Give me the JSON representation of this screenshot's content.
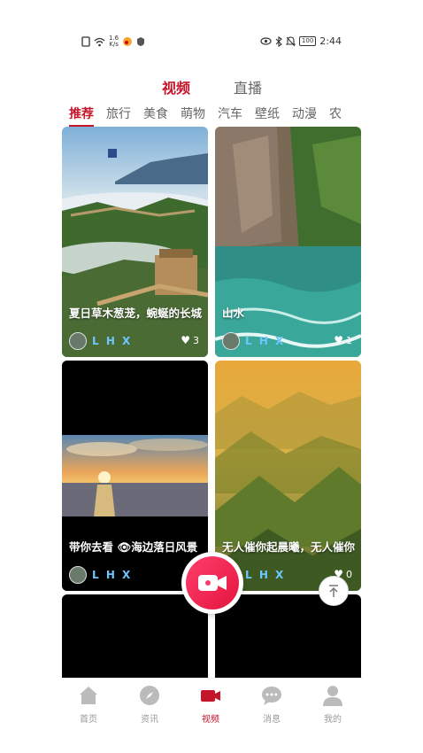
{
  "status_bar": {
    "speed_value": "1.6",
    "speed_unit": "K/s",
    "battery": "100",
    "time": "2:44"
  },
  "top_tabs": [
    {
      "label": "视频",
      "active": true
    },
    {
      "label": "直播",
      "active": false
    }
  ],
  "categories": [
    "推荐",
    "旅行",
    "美食",
    "萌物",
    "汽车",
    "壁纸",
    "动漫",
    "农"
  ],
  "selected_category": "推荐",
  "feed": [
    {
      "title": "夏日草木葱茏，蜿蜒的长城",
      "user": "L H X",
      "likes": "3",
      "image": "great-wall-mountains"
    },
    {
      "title": "山水",
      "user": "L H X",
      "likes": "1",
      "image": "river-cliffs"
    },
    {
      "title": "带你去看 👁海边落日风景",
      "user": "L H X",
      "likes": "",
      "image": "sea-sunset"
    },
    {
      "title": "无人催你起晨曦，无人催你",
      "user": "L H X",
      "likes": "0",
      "image": "misty-mountains"
    }
  ],
  "bottom_nav": [
    {
      "label": "首页",
      "icon": "home-icon"
    },
    {
      "label": "资讯",
      "icon": "compass-icon"
    },
    {
      "label": "视频",
      "icon": "video-camera-icon",
      "active": true
    },
    {
      "label": "消息",
      "icon": "chat-icon"
    },
    {
      "label": "我的",
      "icon": "user-icon"
    }
  ],
  "colors": {
    "accent": "#c4152b",
    "record_button": "#ff3e6c",
    "username": "#6ec6ff"
  }
}
